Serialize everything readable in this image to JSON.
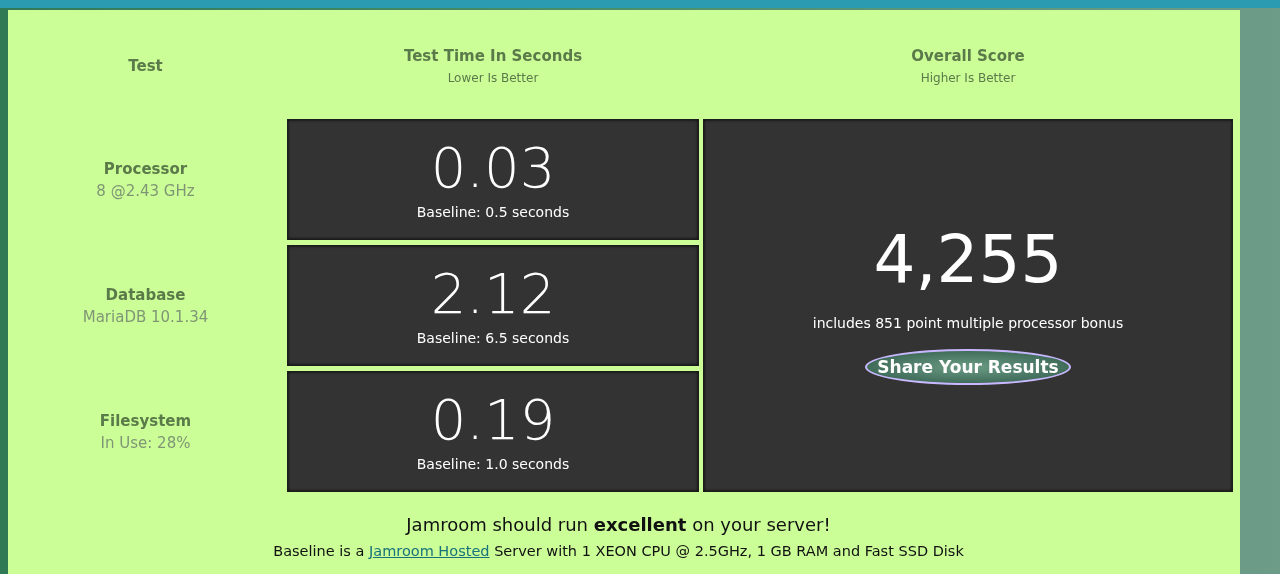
{
  "headers": {
    "test": "Test",
    "time": {
      "title": "Test Time In Seconds",
      "subtitle": "Lower Is Better"
    },
    "score": {
      "title": "Overall Score",
      "subtitle": "Higher Is Better"
    }
  },
  "tests": [
    {
      "name": "Processor",
      "detail": "8 @2.43 GHz",
      "time": "0.03",
      "baseline": "Baseline: 0.5 seconds"
    },
    {
      "name": "Database",
      "detail": "MariaDB 10.1.34",
      "time": "2.12",
      "baseline": "Baseline: 6.5 seconds"
    },
    {
      "name": "Filesystem",
      "detail": "In Use: 28%",
      "time": "0.19",
      "baseline": "Baseline: 1.0 seconds"
    }
  ],
  "score": {
    "value": "4,255",
    "note": "includes 851 point multiple processor bonus",
    "button": "Share Your Results"
  },
  "verdict": "Jamroom should run **excellent** on your server!",
  "baseline_note": {
    "before": "Baseline is a",
    "link": "Jamroom Hosted",
    "after": "Server with 1 XEON CPU @ 2.5GHz, 1 GB RAM and Fast SSD Disk"
  }
}
